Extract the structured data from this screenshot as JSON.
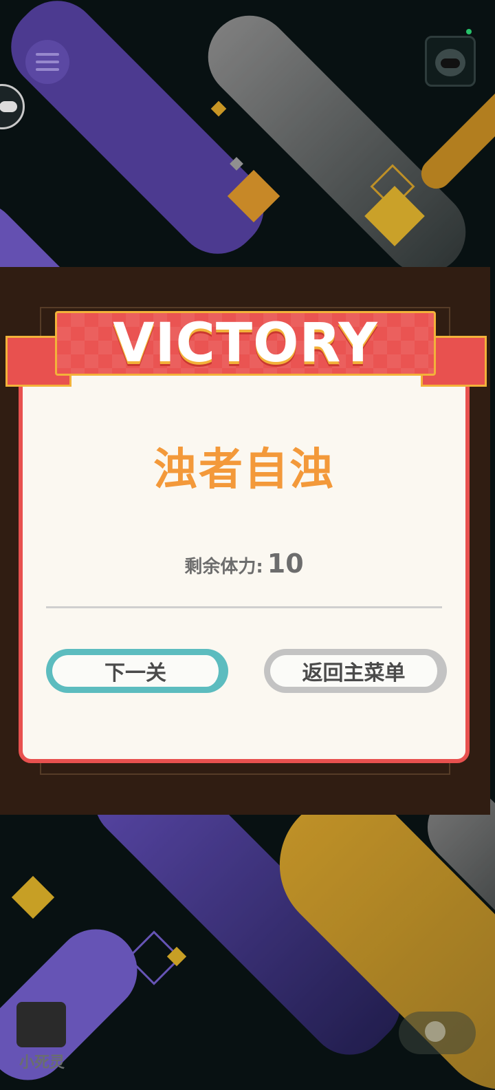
{
  "banner": {
    "title": "VICTORY"
  },
  "dialog": {
    "level_name": "浊者自浊",
    "stamina_label": "剩余体力:",
    "stamina_value": "10",
    "next_button": "下一关",
    "menu_button": "返回主菜单"
  },
  "character": {
    "name": "小死灵"
  },
  "icons": [
    "menu-icon",
    "robot-icon",
    "robot-icon",
    "lightbulb-icon"
  ],
  "colors": {
    "banner_red": "#ea5452",
    "banner_gold": "#f3b23a",
    "title_orange": "#f3993a",
    "next_teal": "#5cbcbf",
    "menu_gray": "#c3c3c3",
    "background": "#0a1517"
  }
}
